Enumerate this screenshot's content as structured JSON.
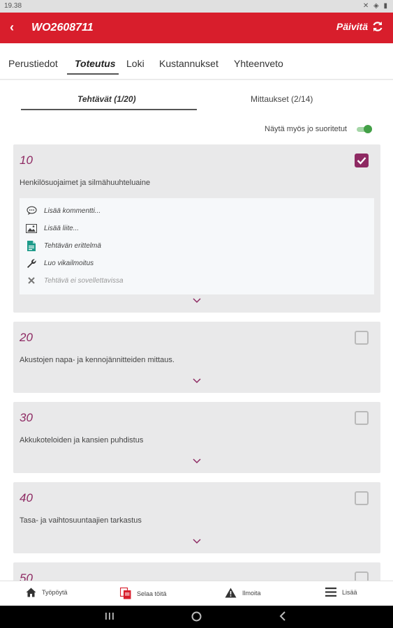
{
  "status_bar": {
    "time": "19.38",
    "icons": "✕ ◈ ▮"
  },
  "app_bar": {
    "back_glyph": "‹",
    "title": "WO2608711",
    "refresh_label": "Päivitä"
  },
  "tabs": [
    "Perustiedot",
    "Toteutus",
    "Loki",
    "Kustannukset",
    "Yhteenveto"
  ],
  "subtabs": {
    "tasks": "Tehtävät (1/20)",
    "measurements": "Mittaukset (2/14)"
  },
  "toggle": {
    "label": "Näytä myös jo suoritetut",
    "on": true
  },
  "accent": "#8e2a63",
  "brand": "#d81e2c",
  "tasks": [
    {
      "number": "10",
      "description": "Henkilösuojaimet ja silmähuuhteluaine",
      "checked": true,
      "expanded": true
    },
    {
      "number": "20",
      "description": "Akustojen napa- ja kennojännitteiden mittaus.",
      "checked": false
    },
    {
      "number": "30",
      "description": "Akkukoteloiden ja kansien puhdistus",
      "checked": false
    },
    {
      "number": "40",
      "description": "Tasa- ja vaihtosuuntaajien tarkastus",
      "checked": false
    },
    {
      "number": "50",
      "description": "",
      "checked": false
    }
  ],
  "actions": [
    {
      "label": "Lisää kommentti...",
      "icon": "comment-icon"
    },
    {
      "label": "Lisää liite...",
      "icon": "image-icon"
    },
    {
      "label": "Tehtävän erittelmä",
      "icon": "document-icon"
    },
    {
      "label": "Luo vikailmoitus",
      "icon": "wrench-icon"
    },
    {
      "label": "Tehtävä ei sovellettavissa",
      "icon": "close-icon"
    }
  ],
  "bottom_nav": [
    {
      "label": "Työpöytä",
      "icon": "home-icon"
    },
    {
      "label": "Selaa töitä",
      "icon": "documents-icon"
    },
    {
      "label": "Ilmoita",
      "icon": "warning-icon"
    },
    {
      "label": "Lisää",
      "icon": "menu-icon"
    }
  ]
}
